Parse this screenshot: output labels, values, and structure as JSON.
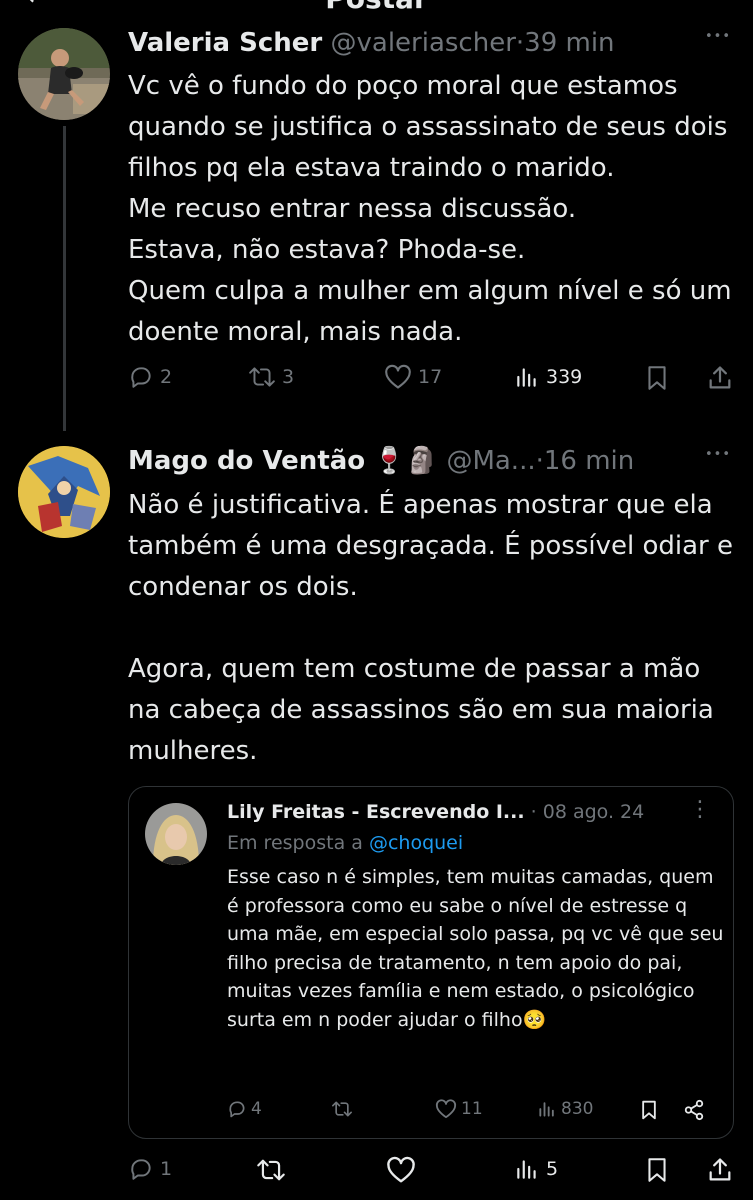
{
  "header": {
    "title": "Postar",
    "back_label": "←"
  },
  "tweets": [
    {
      "name": "Valeria Scher",
      "handle": "@valeriascher",
      "sep": "·",
      "time": "39 min",
      "more": "•••",
      "text": [
        "Vc vê o fundo do poço moral que estamos quando se justifica o assassinato de seus dois filhos pq ela estava traindo o marido.",
        "Me recuso entrar nessa discussão.",
        "Estava, não estava? Phoda-se.",
        "Quem culpa a mulher em algum nível e só um doente moral, mais nada."
      ],
      "replies": "2",
      "reposts": "3",
      "likes": "17",
      "views": "339"
    },
    {
      "name": "Mago do Ventão",
      "emoji": "🍷🗿",
      "handle": "@Ma...",
      "sep": "·",
      "time": "16 min",
      "more": "•••",
      "text": [
        "Não é justificativa. É apenas mostrar que ela também é uma desgraçada. É possível odiar e condenar os dois.",
        "Agora, quem tem costume de passar a mão na cabeça de assassinos são em sua maioria mulheres."
      ],
      "replies": "1",
      "reposts": "",
      "likes": "",
      "views": "5"
    }
  ],
  "quote": {
    "name": "Lily Freitas - Escrevendo I...",
    "sep": "·",
    "date": "08 ago. 24",
    "more": "⋮",
    "reply_prefix": "Em resposta a",
    "reply_handle": "@choquei",
    "text": "Esse caso n é simples, tem muitas camadas, quem é professora como eu sabe o nível de estresse q uma mãe, em especial solo passa, pq vc vê que seu filho precisa de tratamento, n tem apoio do pai, muitas vezes família e nem estado, o psicológico surta em n poder ajudar o filho🥺",
    "replies": "4",
    "reposts": "",
    "likes": "11",
    "views": "830"
  },
  "colors": {
    "background": "#000000",
    "text": "#e7e9ea",
    "muted": "#71767b",
    "link": "#1d9bf0",
    "border": "#2f3336"
  },
  "icons": [
    "back-arrow-icon",
    "more-icon",
    "reply-icon",
    "repost-icon",
    "like-icon",
    "views-icon",
    "bookmark-icon",
    "share-icon"
  ]
}
